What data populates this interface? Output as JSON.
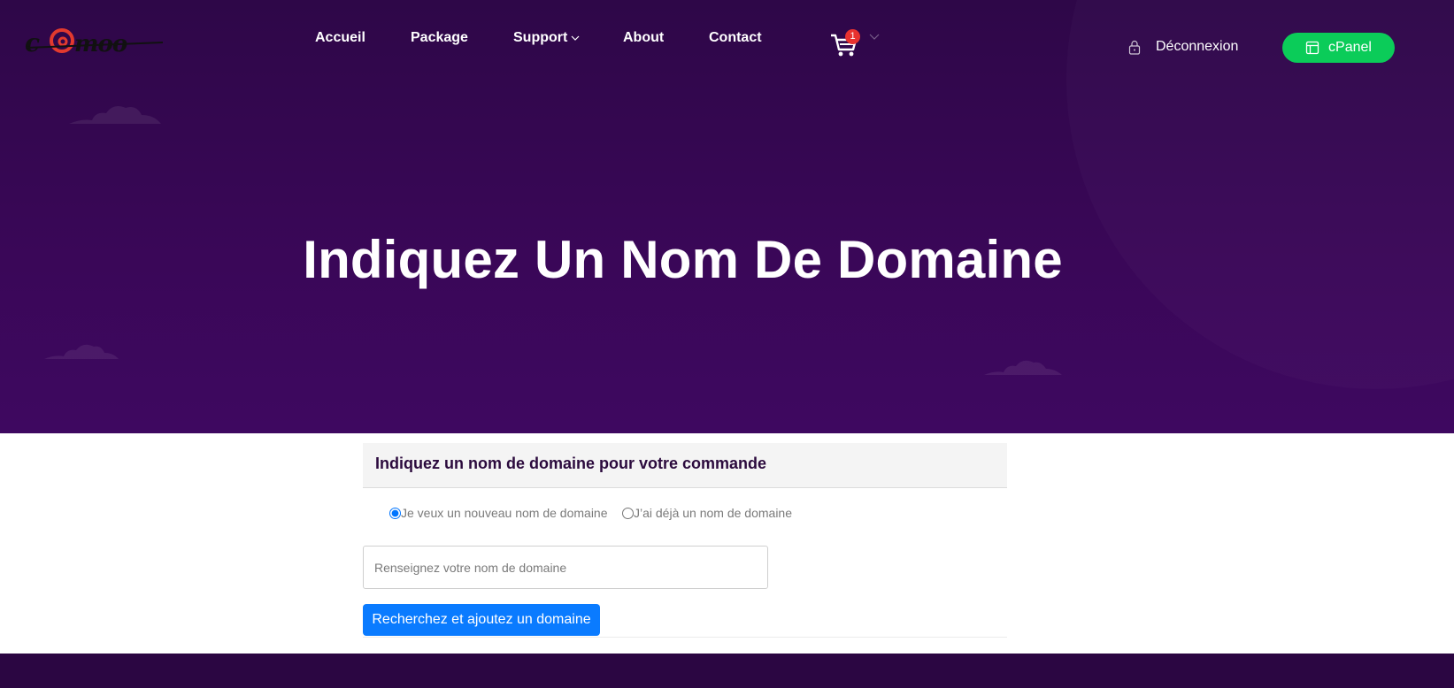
{
  "brand": {
    "logo_text": "c@moo",
    "logo_icon": "camoo-logo"
  },
  "nav": {
    "items": [
      {
        "label": "Accueil"
      },
      {
        "label": "Package"
      },
      {
        "label": "Support",
        "has_dropdown": true
      },
      {
        "label": "About"
      },
      {
        "label": "Contact"
      }
    ]
  },
  "cart": {
    "icon": "cart-icon",
    "count": "1"
  },
  "account": {
    "logout_label": "Déconnexion",
    "cpanel_label": "cPanel"
  },
  "hero": {
    "title": "Indiquez Un Nom De Domaine"
  },
  "form": {
    "card_title": "Indiquez un nom de domaine pour votre commande",
    "radio_new_label": "Je veux un nouveau nom de domaine",
    "radio_existing_label": "J’ai déjà un nom de domaine",
    "selected_option": "new",
    "domain_input_value": "",
    "domain_input_placeholder": "Renseignez votre nom de domaine",
    "submit_label": "Recherchez et ajoutez un domaine"
  },
  "colors": {
    "hero_bg": "#3a0758",
    "cpanel_green": "#0bcc59",
    "primary_blue": "#0a7bff",
    "cart_badge_red": "#e8322f",
    "footer_bg": "#2b0642"
  }
}
